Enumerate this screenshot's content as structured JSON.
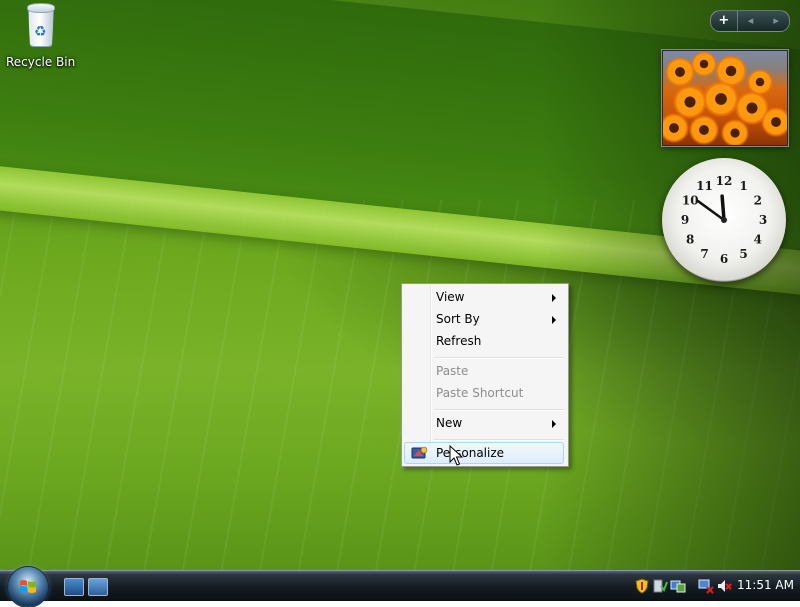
{
  "desktop": {
    "icons": [
      {
        "label": "Recycle Bin",
        "icon": "recycle-bin-icon"
      }
    ]
  },
  "sidebar": {
    "controls": {
      "add": "+",
      "prev": "◂",
      "next": "▸"
    },
    "gadgets": [
      "slideshow",
      "clock"
    ],
    "clock_numerals": [
      "12",
      "1",
      "2",
      "3",
      "4",
      "5",
      "6",
      "7",
      "8",
      "9",
      "10",
      "11"
    ],
    "clock_time": {
      "hour": 11,
      "minute": 51
    }
  },
  "context_menu": {
    "items": [
      {
        "label": "View",
        "submenu": true,
        "enabled": true
      },
      {
        "label": "Sort By",
        "submenu": true,
        "enabled": true
      },
      {
        "label": "Refresh",
        "submenu": false,
        "enabled": true
      },
      {
        "label": "Paste",
        "submenu": false,
        "enabled": false
      },
      {
        "label": "Paste Shortcut",
        "submenu": false,
        "enabled": false
      },
      {
        "label": "New",
        "submenu": true,
        "enabled": true
      },
      {
        "label": "Personalize",
        "submenu": false,
        "enabled": true,
        "highlighted": true,
        "icon": "personalize-icon"
      }
    ]
  },
  "taskbar": {
    "start": "start-orb-icon",
    "quick_launch": [
      "show-desktop-icon",
      "switch-windows-icon"
    ],
    "tray_icons": [
      "security-shield-icon",
      "sidebar-tray-icon",
      "network-icon",
      "network-disconnected-icon",
      "volume-muted-icon"
    ],
    "time": "11:51 AM"
  },
  "colors": {
    "menu_highlight": "#ddedfb",
    "menu_highlight_border": "#a8d8f3",
    "disabled_text": "#8d8d8d",
    "taskbar": "#141c22"
  }
}
